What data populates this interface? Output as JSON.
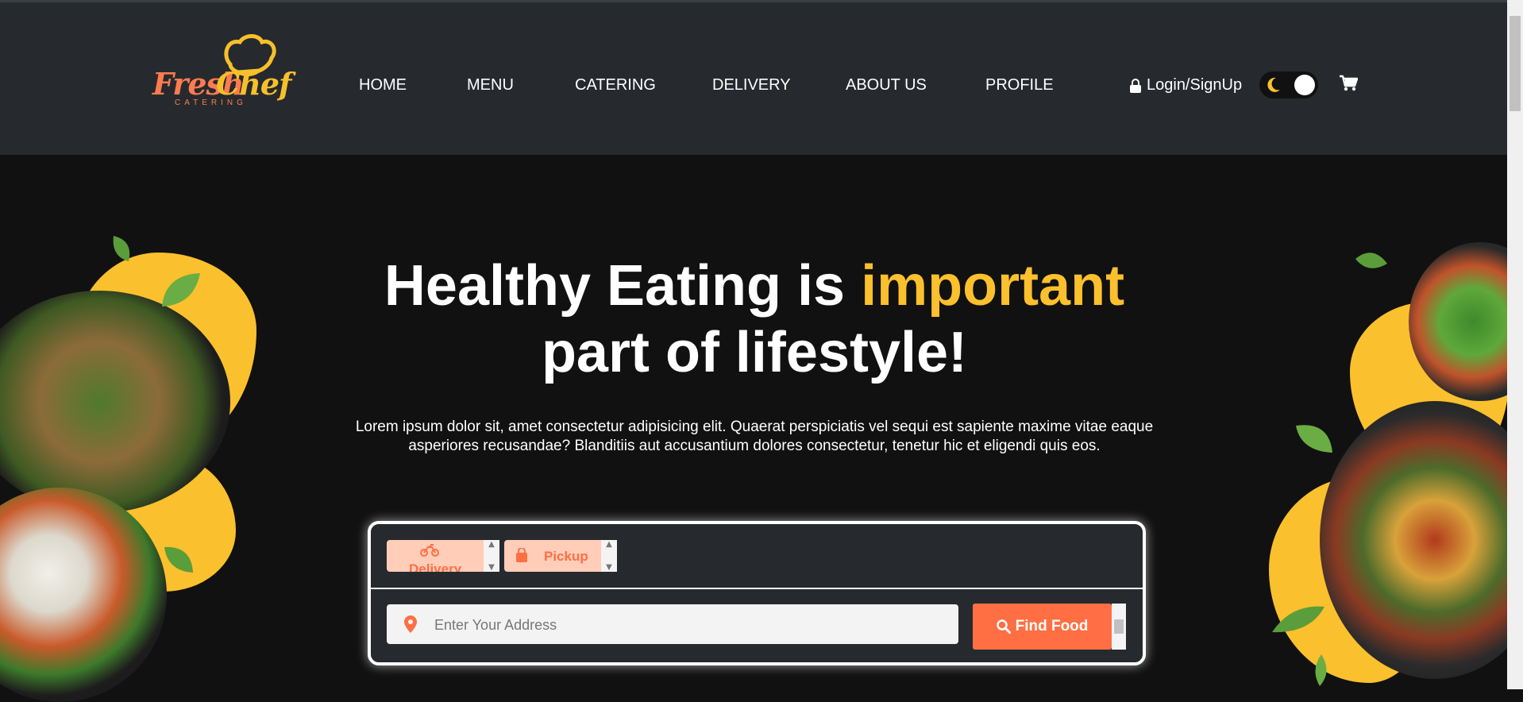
{
  "brand": {
    "name_part1": "Fresh",
    "name_part2": "Chef",
    "tagline": "CATERING"
  },
  "nav": [
    "HOME",
    "MENU",
    "CATERING",
    "DELIVERY",
    "ABOUT US",
    "PROFILE"
  ],
  "auth": {
    "label": "Login/SignUp",
    "icon": "lock-icon"
  },
  "theme_toggle": {
    "icon": "moon-icon",
    "state": "dark"
  },
  "cart": {
    "icon": "cart-icon"
  },
  "hero": {
    "title_part1": "Healthy Eating is ",
    "title_highlight": "important",
    "title_part2": "part of lifestyle!",
    "description": "Lorem ipsum dolor sit, amet consectetur adipisicing elit. Quaerat perspiciatis vel sequi est sapiente maxime vitae eaque asperiores recusandae? Blanditiis aut accusantium dolores consectetur, tenetur hic et eligendi quis eos."
  },
  "search": {
    "options": [
      {
        "label": "Delivery",
        "icon": "motorbike-icon"
      },
      {
        "label": "Pickup",
        "icon": "shopping-bag-icon"
      }
    ],
    "address_placeholder": "Enter Your Address",
    "submit_label": "Find Food"
  },
  "colors": {
    "accent": "#ff6f43",
    "highlight": "#fbc02d",
    "header_bg": "#262a2e",
    "page_bg": "#111111"
  }
}
